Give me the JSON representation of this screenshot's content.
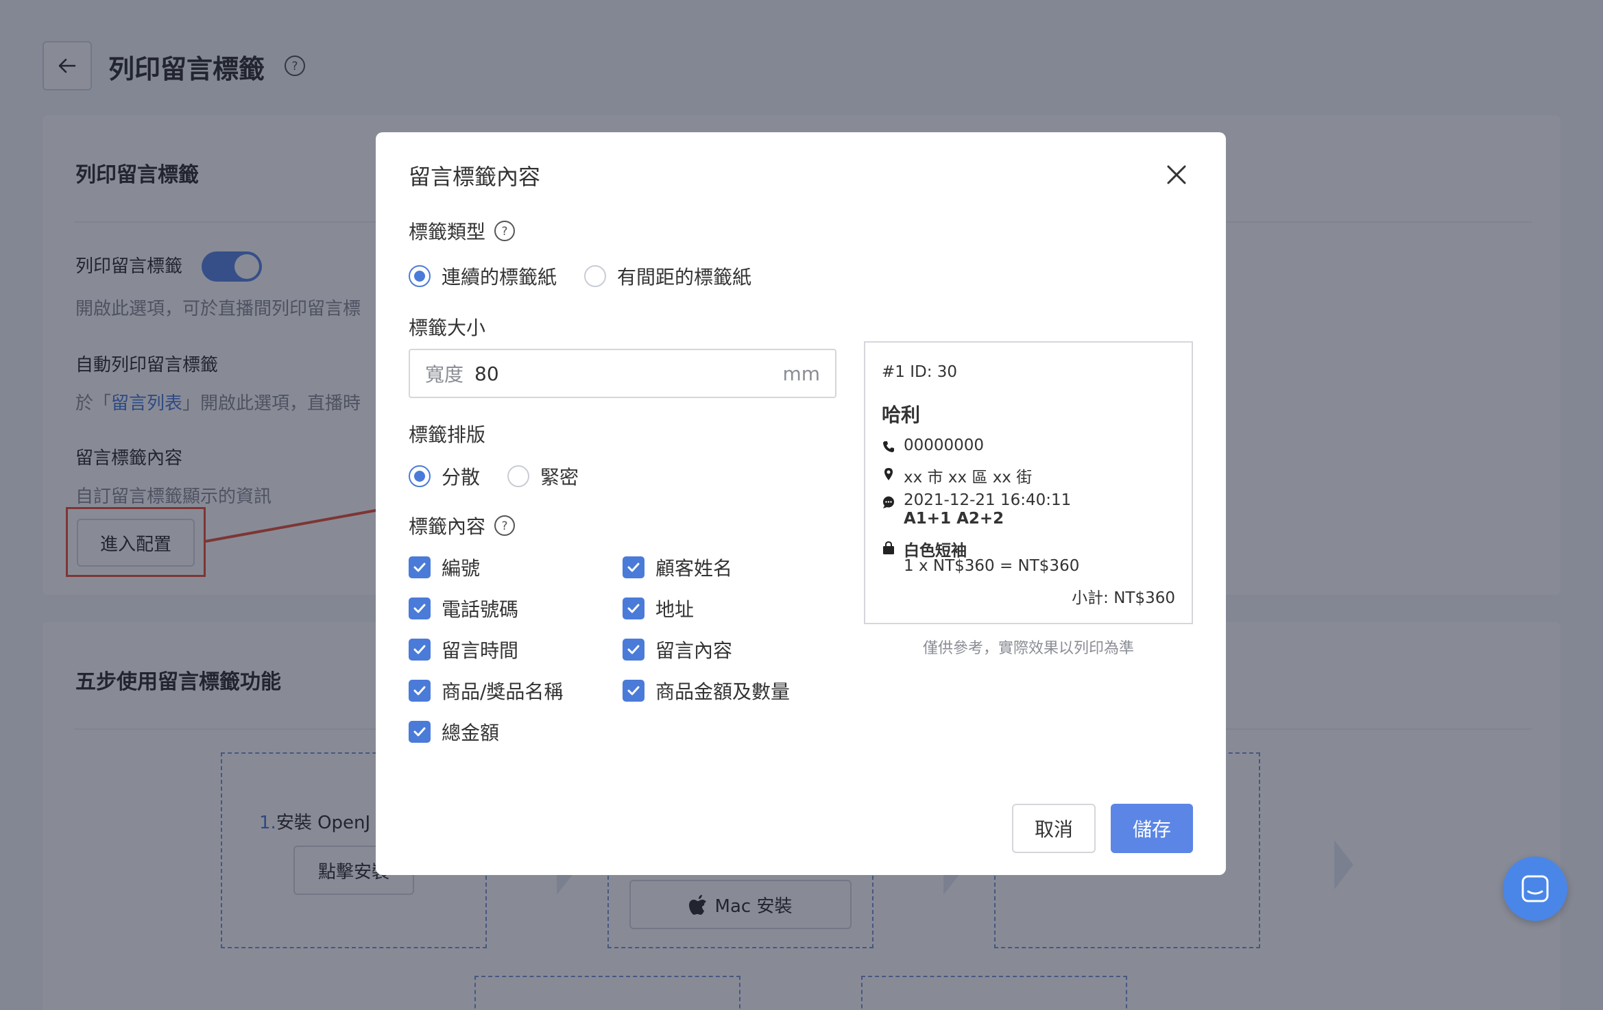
{
  "page": {
    "title": "列印留言標籤"
  },
  "settings_card": {
    "title": "列印留言標籤",
    "print_label": "列印留言標籤",
    "print_desc": "開啟此選項，可於直播間列印留言標",
    "auto_label": "自動列印留言標籤",
    "auto_desc_prefix": "於「",
    "auto_desc_link": "留言列表",
    "auto_desc_suffix": "」開啟此選項，直播時",
    "content_label": "留言標籤內容",
    "content_desc": "自訂留言標籤顯示的資訊",
    "enter_button": "進入配置"
  },
  "steps_card": {
    "title": "五步使用留言標籤功能",
    "step1_num": "1.",
    "step1_label": "安裝 OpenJ",
    "step1_button": "點擊安裝",
    "mac_button": "Mac 安裝"
  },
  "modal": {
    "title": "留言標籤內容",
    "label_type": {
      "title": "標籤類型",
      "options": [
        "連續的標籤紙",
        "有間距的標籤紙"
      ],
      "selected": 0
    },
    "label_size": {
      "title": "標籤大小",
      "prefix": "寬度",
      "value": "80",
      "unit": "mm"
    },
    "label_layout": {
      "title": "標籤排版",
      "options": [
        "分散",
        "緊密"
      ],
      "selected": 0
    },
    "label_content": {
      "title": "標籤內容",
      "items": [
        "編號",
        "顧客姓名",
        "電話號碼",
        "地址",
        "留言時間",
        "留言內容",
        "商品/獎品名稱",
        "商品金額及數量",
        "總金額"
      ]
    },
    "preview": {
      "header": "#1   ID: 30",
      "name": "哈利",
      "phone": "00000000",
      "address": "xx 市 xx 區 xx 街",
      "time": "2021-12-21 16:40:11",
      "comment": "A1+1 A2+2",
      "product": "白色短袖",
      "price_line": "1 x NT$360 = NT$360",
      "subtotal": "小計: NT$360",
      "note": "僅供參考，實際效果以列印為準"
    },
    "cancel_button": "取消",
    "save_button": "儲存"
  },
  "colors": {
    "primary": "#5b86e5",
    "checkbox": "#4a7bd8",
    "highlight": "#e8553a"
  }
}
